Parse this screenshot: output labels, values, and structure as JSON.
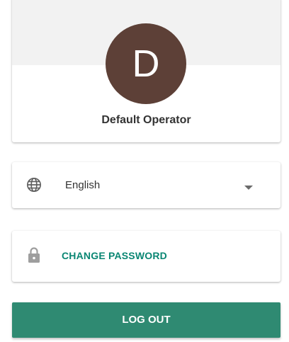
{
  "profile": {
    "avatar_initial": "D",
    "operator_name": "Default Operator",
    "avatar_color": "#5d4037"
  },
  "language": {
    "icon": "globe-icon",
    "selected": "English"
  },
  "password": {
    "icon": "lock-icon",
    "label": "CHANGE PASSWORD",
    "label_color": "#0a8673"
  },
  "logout": {
    "label": "LOG OUT",
    "color": "#2f8a72"
  }
}
